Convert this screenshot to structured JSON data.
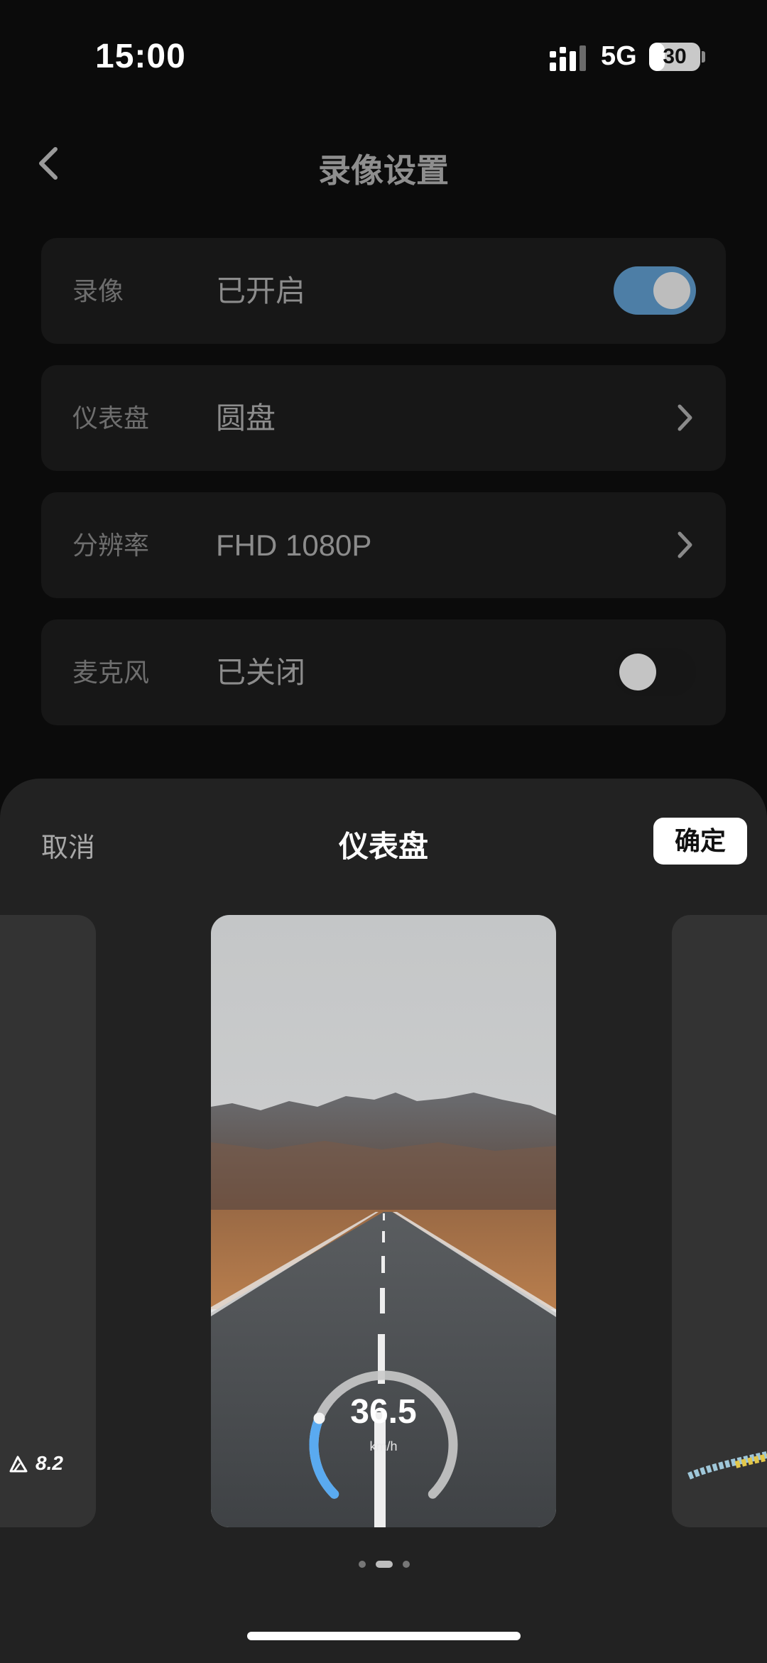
{
  "status_bar": {
    "time": "15:00",
    "network": "5G",
    "battery": "30",
    "battery_level": 0.3
  },
  "nav": {
    "title": "录像设置",
    "back_icon": "chevron-left-icon"
  },
  "settings": {
    "recording": {
      "label": "录像",
      "value": "已开启",
      "toggle_on": true
    },
    "dashboard": {
      "label": "仪表盘",
      "value": "圆盘"
    },
    "resolution": {
      "label": "分辨率",
      "value": "FHD 1080P"
    },
    "microphone": {
      "label": "麦克风",
      "value": "已关闭",
      "toggle_on": false
    }
  },
  "sheet": {
    "title": "仪表盘",
    "cancel": "取消",
    "confirm": "确定",
    "left_card_metric": "8.2",
    "preview_speed": "36.5",
    "preview_unit": "km/h",
    "speed_gauge_level": 0.25,
    "pages": 3,
    "active_page": 1
  },
  "colors": {
    "toggle_on": "#4d7ea6",
    "toggle_off": "#161616",
    "sheet_bg": "#222222",
    "gauge_accent": "#5aaaf0"
  }
}
